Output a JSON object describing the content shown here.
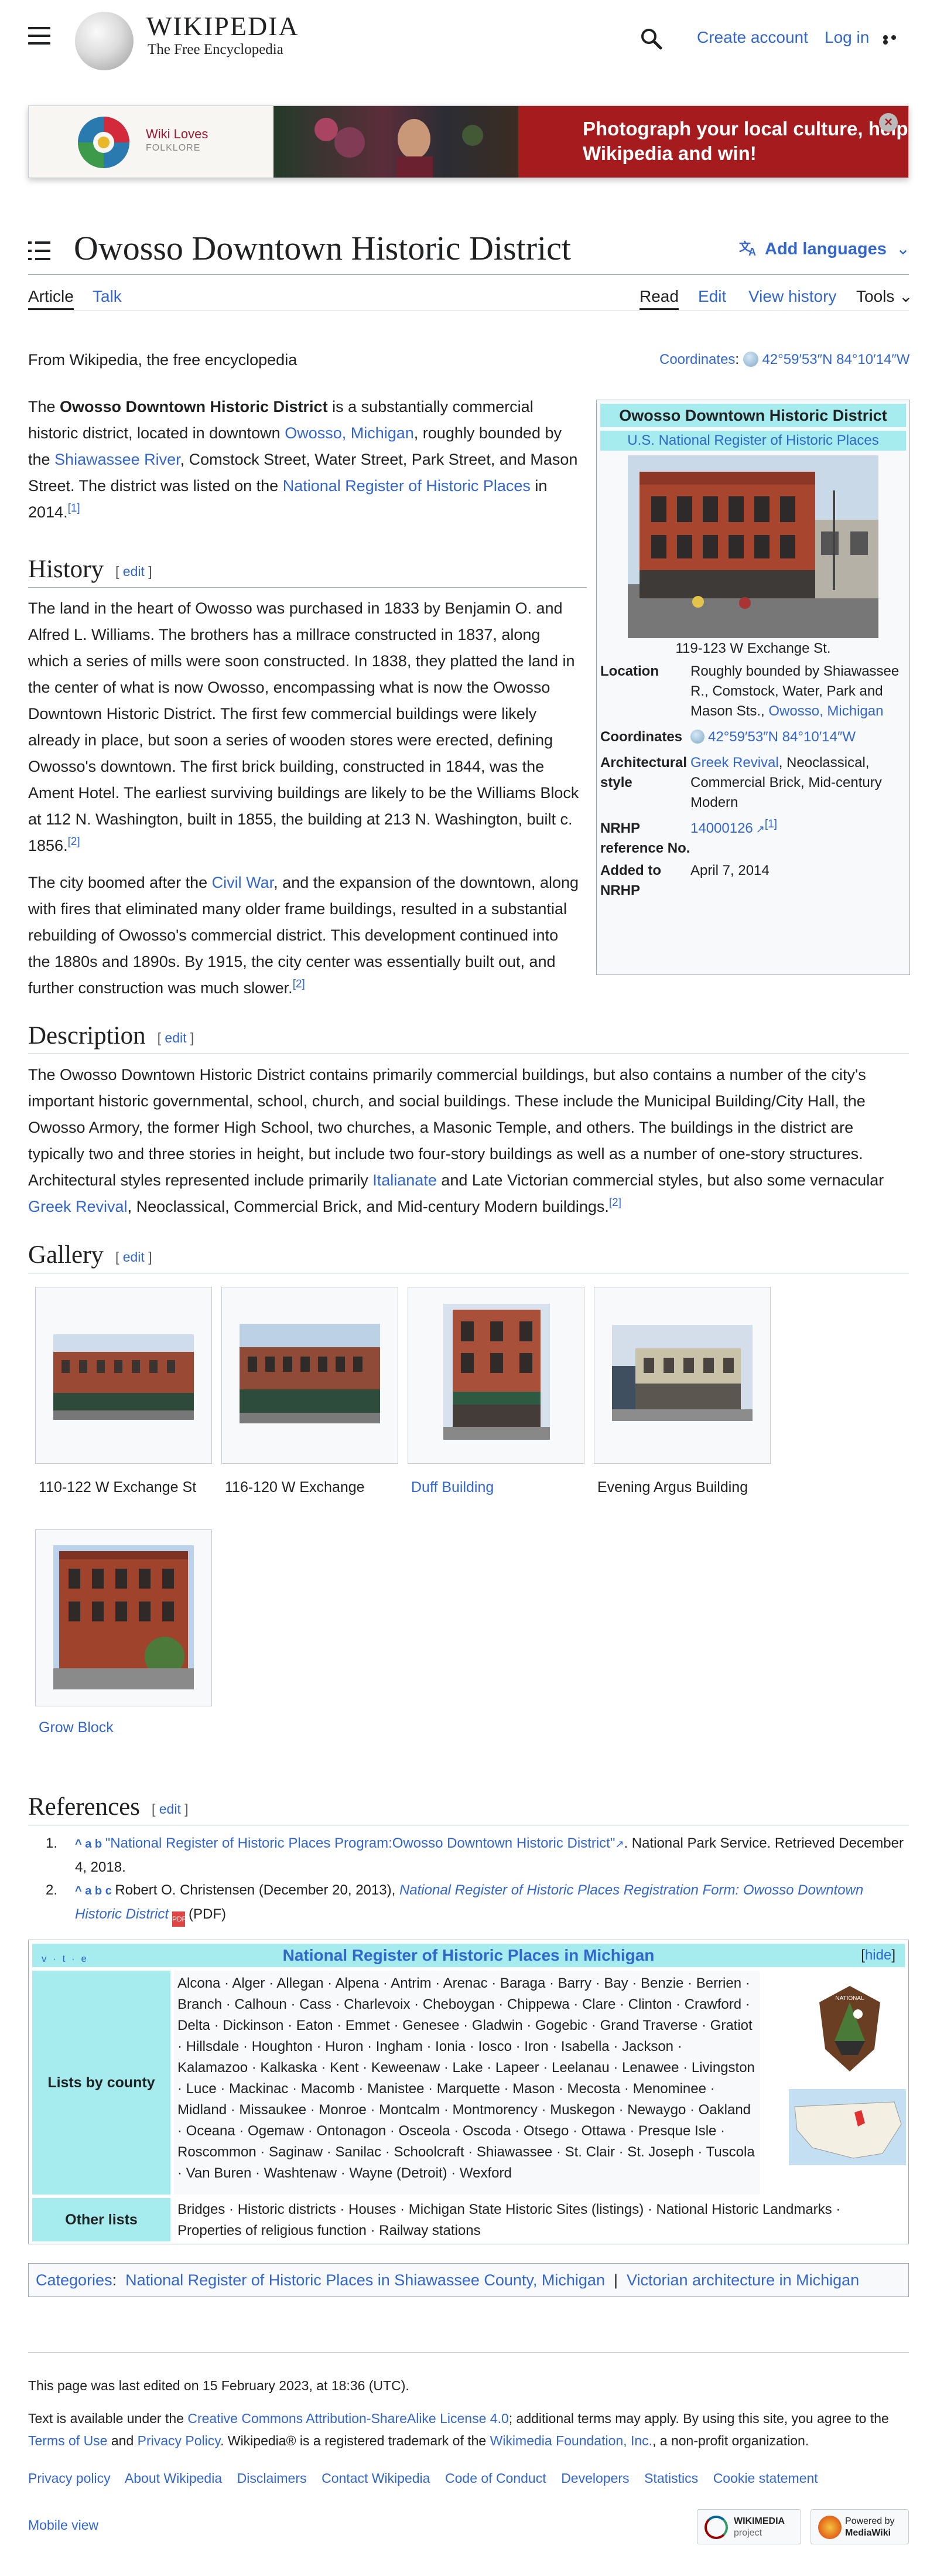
{
  "header": {
    "wordmark": "WIKIPEDIA",
    "tagline": "The Free Encyclopedia",
    "create_account": "Create account",
    "log_in": "Log in"
  },
  "banner": {
    "brand_line1": "Wiki Loves",
    "brand_line2": "FOLKLORE",
    "message": "Photograph your local culture, help Wikipedia and win!",
    "close": "×"
  },
  "page": {
    "title": "Owosso Downtown Historic District",
    "add_languages": "Add languages",
    "tabs": {
      "article": "Article",
      "talk": "Talk",
      "read": "Read",
      "edit": "Edit",
      "history": "View history",
      "tools": "Tools"
    },
    "from_wiki": "From Wikipedia, the free encyclopedia",
    "coords_label": "Coordinates",
    "coords_value": "42°59′53″N 84°10′14″W"
  },
  "intro": {
    "t1": "The ",
    "bold": "Owosso Downtown Historic District",
    "t2": " is a substantially commercial historic district, located in downtown ",
    "link1": "Owosso, Michigan",
    "t3": ", roughly bounded by the ",
    "link2": "Shiawassee River",
    "t4": ", Comstock Street, Water Street, Park Street, and Mason Street. The district was listed on the ",
    "link3": "National Register of Historic Places",
    "t5": " in 2014.",
    "ref": "[1]"
  },
  "history": {
    "heading": "History",
    "edit": "edit",
    "p1": "The land in the heart of Owosso was purchased in 1833 by Benjamin O. and Alfred L. Williams. The brothers has a millrace constructed in 1837, along which a series of mills were soon constructed. In 1838, they platted the land in the center of what is now Owosso, encompassing what is now the Owosso Downtown Historic District. The first few commercial buildings were likely already in place, but soon a series of wooden stores were erected, defining Owosso's downtown. The first brick building, constructed in 1844, was the Ament Hotel. The earliest surviving buildings are likely to be the Williams Block at 112 N. Washington, built in 1855, the building at 213 N. Washington, built c. 1856.",
    "p1_ref": "[2]",
    "p2a": "The city boomed after the ",
    "p2_link": "Civil War",
    "p2b": ", and the expansion of the downtown, along with fires that eliminated many older frame buildings, resulted in a substantial rebuilding of Owosso's commercial district. This development continued into the 1880s and 1890s. By 1915, the city center was essentially built out, and further construction was much slower.",
    "p2_ref": "[2]"
  },
  "infobox": {
    "title": "Owosso Downtown Historic District",
    "subtitle": "U.S. National Register of Historic Places",
    "caption": "119-123 W Exchange St.",
    "rows": [
      {
        "k": "Location",
        "v": "Roughly bounded by Shiawassee R., Comstock, Water, Park and Mason Sts.,",
        "link": "Owosso, Michigan"
      },
      {
        "k": "Coordinates",
        "link": "42°59′53″N 84°10′14″W"
      },
      {
        "k": "Architectural style",
        "link": "Greek Revival",
        "v": ", Neoclassical, Commercial Brick, Mid-century Modern"
      },
      {
        "k": "NRHP reference No.",
        "link": "14000126",
        "v": "[1]"
      },
      {
        "k": "Added to NRHP",
        "v": "April 7, 2014"
      }
    ]
  },
  "description": {
    "heading": "Description",
    "edit": "edit",
    "text1": "The Owosso Downtown Historic District contains primarily commercial buildings, but also contains a number of the city's important historic governmental, school, church, and social buildings. These include the Municipal Building/City Hall, the Owosso Armory, the former High School, two churches, a Masonic Temple, and others. The buildings in the district are typically two and three stories in height, but include two four-story buildings as well as a number of one-story structures. Architectural styles represented include primarily ",
    "link1": "Italianate",
    "text2": " and Late Victorian commercial styles, but also some vernacular ",
    "link2": "Greek Revival",
    "text3": ", Neoclassical, Commercial Brick, and Mid-century Modern buildings.",
    "ref": "[2]"
  },
  "gallery": {
    "heading": "Gallery",
    "edit": "edit",
    "items": [
      "110-122 W Exchange St",
      "116-120 W Exchange",
      "Duff Building",
      "Evening Argus Building",
      "Grow Block"
    ]
  },
  "references": {
    "heading": "References",
    "edit": "edit",
    "r1_marks": "^ a b ",
    "r1_link": "\"National Register of Historic Places Program:Owosso Downtown Historic District\"",
    "r1_rest": ". National Park Service. Retrieved December 4, 2018.",
    "r2_marks": "^ a b c ",
    "r2_author": "Robert O. Christensen (December 20, 2013), ",
    "r2_link": "National Register of Historic Places Registration Form: Owosso Downtown Historic District",
    "r2_pdf": "(PDF)"
  },
  "navbox": {
    "vte": "v · t · e",
    "title": "National Register of Historic Places in Michigan",
    "hide": "[hide]",
    "group1": "Lists by county",
    "group2": "Other lists",
    "counties": "Alcona · Alger · Allegan · Alpena · Antrim · Arenac · Baraga · Barry · Bay · Benzie · Berrien · Branch · Calhoun · Cass · Charlevoix · Cheboygan · Chippewa · Clare · Clinton · Crawford · Delta · Dickinson · Eaton · Emmet · Genesee · Gladwin · Gogebic · Grand Traverse · Gratiot · Hillsdale · Houghton · Huron · Ingham · Ionia · Iosco · Iron · Isabella · Jackson · Kalamazoo · Kalkaska · Kent · Keweenaw · Lake · Lapeer · Leelanau · Lenawee · Livingston · Luce · Mackinac · Macomb · Manistee · Marquette · Mason · Mecosta · Menominee · Midland · Missaukee · Monroe · Montcalm · Montmorency · Muskegon · Newaygo · Oakland · Oceana · Ogemaw · Ontonagon · Osceola · Oscoda · Otsego · Ottawa · Presque Isle · Roscommon · Saginaw · Sanilac · Schoolcraft · Shiawassee · St. Clair · St. Joseph · Tuscola · Van Buren · Washtenaw · Wayne (Detroit) · Wexford",
    "others": "Bridges · Historic districts · Houses · Michigan State Historic Sites (listings) · National Historic Landmarks · Properties of religious function · Railway stations"
  },
  "categories": {
    "label": "Categories",
    "c1": "National Register of Historic Places in Shiawassee County, Michigan",
    "c2": "Victorian architecture in Michigan"
  },
  "footer": {
    "last_edited": "This page was last edited on 15 February 2023, at 18:36 (UTC).",
    "license_a": "Text is available under the ",
    "license_link": "Creative Commons Attribution-ShareAlike License 4.0",
    "license_b": "; additional terms may apply. By using this site, you agree to the ",
    "terms": "Terms of Use",
    "and": " and ",
    "privacy": "Privacy Policy",
    "license_c": ". Wikipedia® is a registered trademark of the ",
    "wmf": "Wikimedia Foundation, Inc.",
    "license_d": ", a non-profit organization.",
    "links": [
      "Privacy policy",
      "About Wikipedia",
      "Disclaimers",
      "Contact Wikipedia",
      "Code of Conduct",
      "Developers",
      "Statistics",
      "Cookie statement"
    ],
    "mobile": "Mobile view",
    "badge1_line1": "WIKIMEDIA",
    "badge1_line2": "project",
    "badge2_line1": "Powered by",
    "badge2_line2": "MediaWiki"
  }
}
